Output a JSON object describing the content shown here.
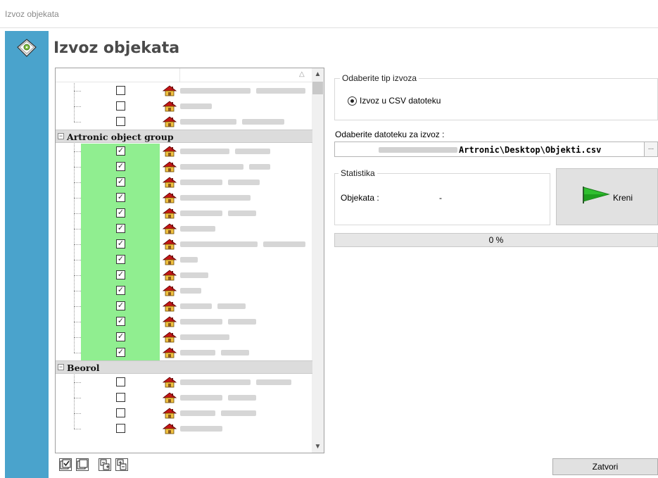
{
  "window": {
    "title": "Izvoz objekata"
  },
  "header": {
    "title": "Izvoz objekata",
    "icon": "export-disc-icon"
  },
  "tree": {
    "groups": [
      {
        "name": "",
        "items": [
          {
            "checked": false
          },
          {
            "checked": false
          },
          {
            "checked": false
          }
        ]
      },
      {
        "name": "Artronic object group",
        "items": [
          {
            "checked": true
          },
          {
            "checked": true
          },
          {
            "checked": true
          },
          {
            "checked": true
          },
          {
            "checked": true
          },
          {
            "checked": true
          },
          {
            "checked": true
          },
          {
            "checked": true
          },
          {
            "checked": true
          },
          {
            "checked": true
          },
          {
            "checked": true
          },
          {
            "checked": true
          },
          {
            "checked": true
          },
          {
            "checked": true
          }
        ]
      },
      {
        "name": "Beorol",
        "items": [
          {
            "checked": false
          },
          {
            "checked": false
          },
          {
            "checked": false
          },
          {
            "checked": false
          }
        ]
      }
    ],
    "highlight_color": "#90ee90"
  },
  "export_type": {
    "legend": "Odaberite tip izvoza",
    "option_label": "Izvoz u CSV datoteku",
    "selected": true
  },
  "file": {
    "label": "Odaberite datoteku za izvoz :",
    "path_visible": "Artronic\\Desktop\\Objekti.csv",
    "browse_label": "..."
  },
  "stats": {
    "legend": "Statistika",
    "objects_label": "Objekata :",
    "objects_value": "-"
  },
  "start_button": {
    "label": "Kreni",
    "icon": "green-flag-icon"
  },
  "progress": {
    "text": "0 %",
    "value": 0
  },
  "close_button": {
    "label": "Zatvori"
  },
  "accent_color": "#4aa3cc"
}
